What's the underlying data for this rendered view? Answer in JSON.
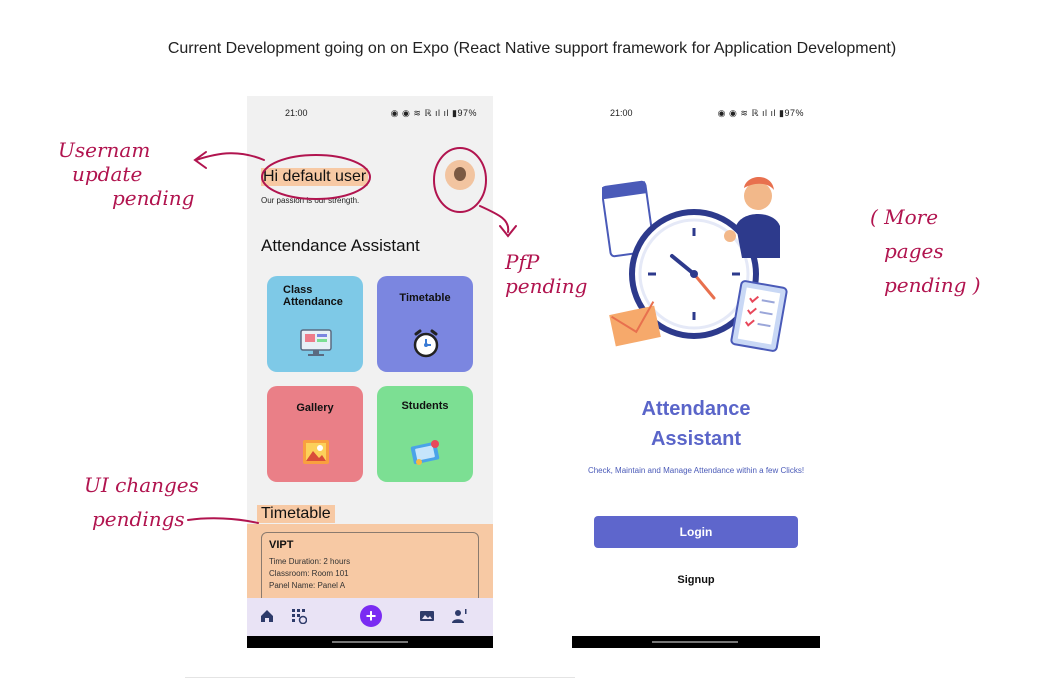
{
  "heading": "Current Development going on on Expo (React Native support framework for Application Development)",
  "phone1": {
    "status_time": "21:00",
    "status_icons": "◉ ◉ ≋ ℝ ıl ıl ▮97%",
    "greeting": "Hi default user",
    "tagline": "Our passion is our strength.",
    "app_title": "Attendance Assistant",
    "cards": [
      {
        "label": "Class Attendance",
        "icon": "monitor-icon"
      },
      {
        "label": "Timetable",
        "icon": "alarm-clock-icon"
      },
      {
        "label": "Gallery",
        "icon": "image-icon"
      },
      {
        "label": "Students",
        "icon": "students-icon"
      }
    ],
    "timetable_title": "Timetable",
    "timetable_entry": {
      "name": "VIPT",
      "duration": "Time Duration: 2 hours",
      "classroom": "Classroom: Room 101",
      "panel": "Panel Name: Panel A"
    },
    "nav_icons": [
      "home-icon",
      "timetable-grid-icon",
      "add-icon",
      "gallery-icon",
      "student-icon"
    ]
  },
  "phone2": {
    "status_time": "21:00",
    "status_icons": "◉ ◉ ≋ ℝ ıl ıl ▮97%",
    "title_line1": "Attendance",
    "title_line2": "Assistant",
    "description": "Check, Maintain and Manage Attendance within a few Clicks!",
    "login_label": "Login",
    "signup_label": "Signup"
  },
  "annotations": {
    "username": [
      "Usernam",
      "update",
      "pending"
    ],
    "pfp": [
      "PfP",
      "pending"
    ],
    "more_pages": [
      "( More",
      "pages",
      "pending )"
    ],
    "ui_changes": [
      "UI changes",
      "pendings"
    ]
  },
  "colors": {
    "annotation": "#b1144f",
    "highlight": "#f7c9a4",
    "accent": "#5e66cc"
  }
}
